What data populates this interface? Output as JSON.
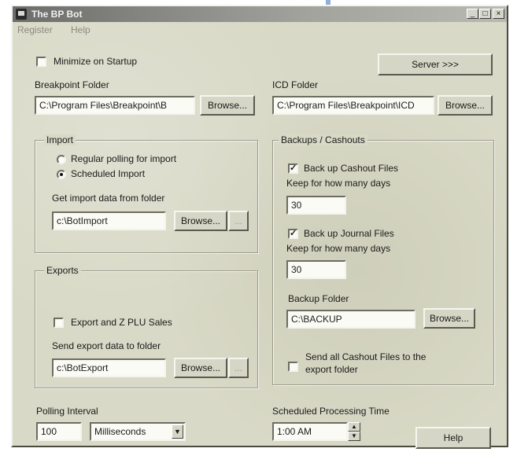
{
  "window": {
    "title": "The BP Bot",
    "minimize_glyph": "_",
    "maximize_glyph": "□",
    "close_glyph": "×"
  },
  "menu": {
    "items": [
      "Register",
      "Help"
    ]
  },
  "minimize_on_startup": {
    "label": "Minimize on Startup",
    "checked": false
  },
  "server_button": "Server >>>",
  "breakpoint_folder": {
    "label": "Breakpoint Folder",
    "value": "C:\\Program Files\\Breakpoint\\B",
    "browse": "Browse..."
  },
  "icd_folder": {
    "label": "ICD Folder",
    "value": "C:\\Program Files\\Breakpoint\\ICD",
    "browse": "Browse..."
  },
  "import": {
    "title": "Import",
    "regular_polling": "Regular polling for import",
    "scheduled_import": "Scheduled Import",
    "selected": "scheduled",
    "folder_label": "Get import data from folder",
    "folder_value": "c:\\BotImport",
    "browse": "Browse...",
    "extra": "..."
  },
  "exports": {
    "title": "Exports",
    "export_checkbox": "Export and Z PLU Sales",
    "checked": false,
    "folder_label": "Send export data to folder",
    "folder_value": "c:\\BotExport",
    "browse": "Browse...",
    "extra": "..."
  },
  "backups": {
    "title": "Backups / Cashouts",
    "cashout_label": "Back up Cashout Files",
    "cashout_checked": true,
    "keep_label_1": "Keep for how many days",
    "keep_value_1": "30",
    "journal_label": "Back up Journal Files",
    "journal_checked": true,
    "keep_label_2": "Keep for how many days",
    "keep_value_2": "30",
    "folder_label": "Backup Folder",
    "folder_value": "C:\\BACKUP",
    "browse": "Browse...",
    "send_label_1": "Send all Cashout Files to the",
    "send_label_2": "export folder",
    "send_checked": false
  },
  "polling": {
    "label": "Polling Interval",
    "value": "100",
    "unit": "Milliseconds"
  },
  "schedule": {
    "label": "Scheduled Processing Time",
    "value": "1:00 AM"
  },
  "help_button": "Help",
  "icons": {
    "app": "app-icon",
    "dropdown": "chevron-down-icon",
    "spin": "spin-arrows-icon"
  }
}
